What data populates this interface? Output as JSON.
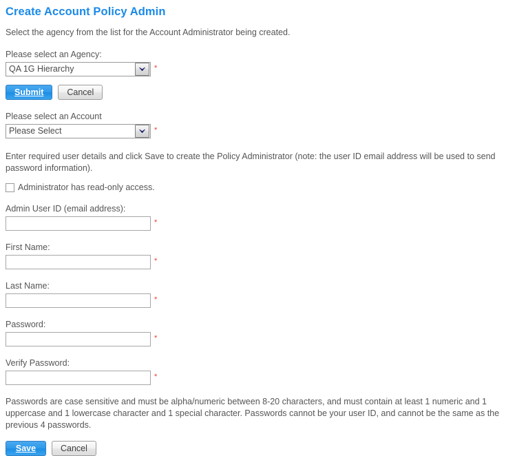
{
  "page": {
    "title": "Create Account Policy Admin",
    "intro": "Select the agency from the list for the Account Administrator being created.",
    "details_note": "Enter required user details and click Save to create the Policy Administrator (note: the user ID email address will be used to send password information).",
    "password_policy": "Passwords are case sensitive and must be alpha/numeric between 8-20 characters, and must contain at least 1 numeric and 1 uppercase and 1 lowercase character and 1 special character. Passwords cannot be your user ID, and cannot be the same as the previous 4 passwords.",
    "required_marker": "*",
    "title_color": "#1b8ae8",
    "required_color": "#ef3b2d"
  },
  "agency": {
    "label": "Please select an Agency:",
    "selected": "QA 1G Hierarchy",
    "options": [
      "QA 1G Hierarchy"
    ]
  },
  "agency_actions": {
    "submit_label": "Submit",
    "cancel_label": "Cancel"
  },
  "account": {
    "label": "Please select an Account",
    "selected": "Please Select",
    "options": [
      "Please Select"
    ]
  },
  "readonly_checkbox": {
    "label": "Administrator has read-only access.",
    "checked": false
  },
  "fields": {
    "admin_user_id": {
      "label": "Admin User ID (email address):",
      "value": "",
      "placeholder": ""
    },
    "first_name": {
      "label": "First Name:",
      "value": "",
      "placeholder": ""
    },
    "last_name": {
      "label": "Last Name:",
      "value": "",
      "placeholder": ""
    },
    "password": {
      "label": "Password:",
      "value": "",
      "placeholder": ""
    },
    "verify_password": {
      "label": "Verify Password:",
      "value": "",
      "placeholder": ""
    }
  },
  "form_actions": {
    "save_label": "Save",
    "save_accesskey": "S",
    "cancel_label": "Cancel"
  }
}
